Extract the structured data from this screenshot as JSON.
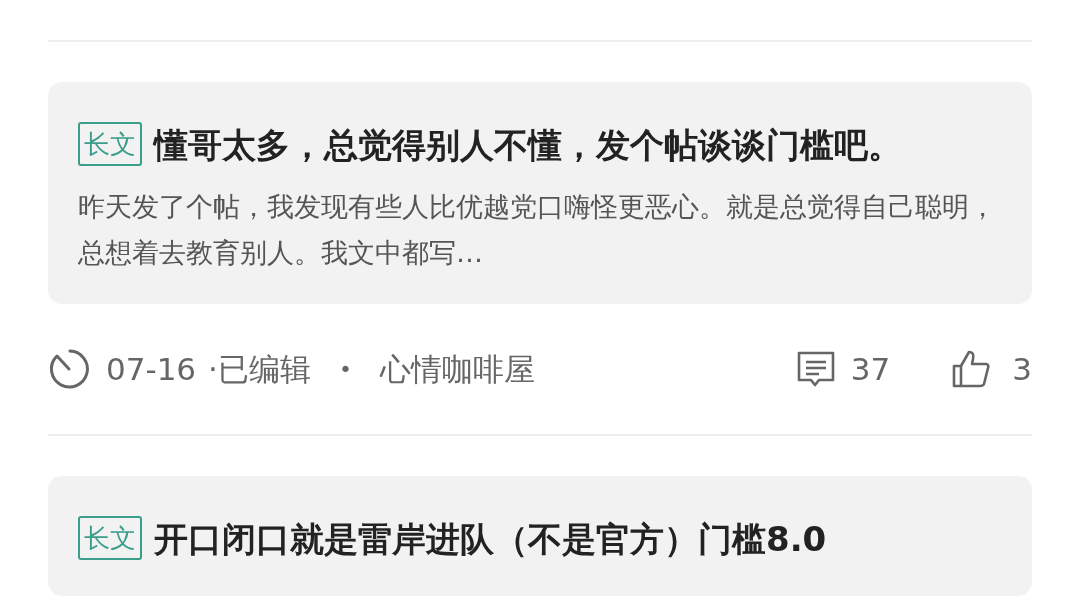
{
  "posts": [
    {
      "tag": "长文",
      "title": "懂哥太多，总觉得别人不懂，发个帖谈谈门槛吧。",
      "excerpt": " 昨天发了个帖，我发现有些人比优越党口嗨怪更恶心。就是总觉得自己聪明，总想着去教育别人。我文中都写…",
      "date": "07-16",
      "edited": "·已编辑",
      "separator": "•",
      "board": "心情咖啡屋",
      "comments": "37",
      "likes": "3"
    },
    {
      "tag": "长文",
      "title": "开口闭口就是雷岸进队（不是官方）门槛8.0"
    }
  ]
}
